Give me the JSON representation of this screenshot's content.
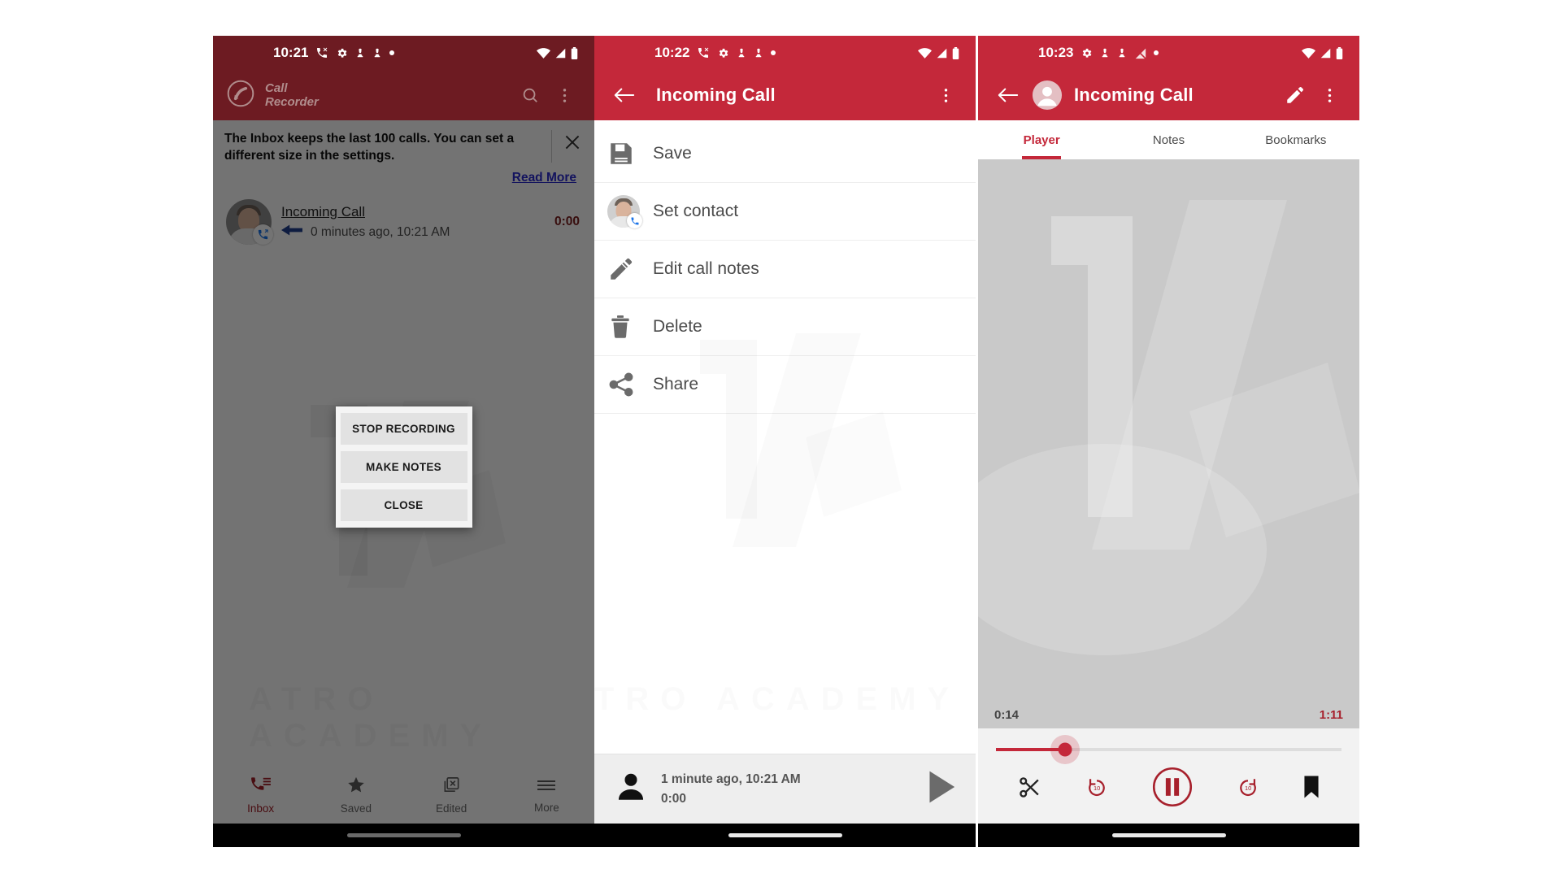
{
  "watermark": {
    "text": "ATRO ACADEMY",
    "brand_letters": "A1"
  },
  "panel1": {
    "status_bar": {
      "time": "10:21",
      "icons": [
        "phone-call-icon",
        "gear-icon",
        "chess-pawn-icon",
        "chess-pawn-icon",
        "dot-icon"
      ],
      "right_icons": [
        "wifi-icon",
        "signal-icon",
        "battery-icon"
      ]
    },
    "app_bar": {
      "logo_icon": "call-recorder-logo-icon",
      "brand_line1": "Call",
      "brand_line2": "Recorder",
      "search_icon": "search-icon",
      "overflow_icon": "more-vertical-icon"
    },
    "banner": {
      "message": "The Inbox keeps the last 100 calls. You can set a different size in the settings.",
      "close_icon": "close-icon",
      "read_more": "Read More"
    },
    "call_row": {
      "title": "Incoming Call",
      "direction_icon": "incoming-arrow-icon",
      "time": "0 minutes ago, 10:21 AM",
      "duration": "0:00",
      "avatar_icon": "contact-avatar",
      "badge_icon": "incoming-call-badge-icon"
    },
    "dialog": {
      "buttons": [
        {
          "label": "STOP RECORDING",
          "name": "stop-recording-button"
        },
        {
          "label": "MAKE NOTES",
          "name": "make-notes-button"
        },
        {
          "label": "CLOSE",
          "name": "close-button"
        }
      ]
    },
    "bottom_nav": [
      {
        "label": "Inbox",
        "icon": "inbox-phone-icon",
        "active": true
      },
      {
        "label": "Saved",
        "icon": "star-icon",
        "active": false
      },
      {
        "label": "Edited",
        "icon": "edited-box-icon",
        "active": false
      },
      {
        "label": "More",
        "icon": "hamburger-icon",
        "active": false
      }
    ]
  },
  "panel2": {
    "status_bar": {
      "time": "10:22",
      "icons": [
        "phone-call-icon",
        "gear-icon",
        "chess-pawn-icon",
        "chess-pawn-icon",
        "dot-icon"
      ],
      "right_icons": [
        "wifi-icon",
        "signal-icon",
        "battery-icon"
      ]
    },
    "app_bar": {
      "back_icon": "back-arrow-icon",
      "title": "Incoming Call",
      "overflow_icon": "more-vertical-icon"
    },
    "menu": [
      {
        "label": "Save",
        "icon": "save-floppy-icon",
        "name": "menu-item-save"
      },
      {
        "label": "Set contact",
        "icon": "contact-avatar-icon",
        "name": "menu-item-set-contact"
      },
      {
        "label": "Edit call notes",
        "icon": "pencil-icon",
        "name": "menu-item-edit-call-notes"
      },
      {
        "label": "Delete",
        "icon": "trash-icon",
        "name": "menu-item-delete"
      },
      {
        "label": "Share",
        "icon": "share-icon",
        "name": "menu-item-share"
      }
    ],
    "mini_player": {
      "avatar_icon": "person-icon",
      "title": "1 minute ago, 10:21 AM",
      "duration": "0:00",
      "play_icon": "play-icon"
    }
  },
  "panel3": {
    "status_bar": {
      "time": "10:23",
      "icons": [
        "gear-icon",
        "chess-pawn-icon",
        "chess-pawn-icon",
        "signal-slash-icon",
        "dot-icon"
      ],
      "right_icons": [
        "wifi-icon",
        "signal-icon",
        "battery-icon"
      ]
    },
    "app_bar": {
      "back_icon": "back-arrow-icon",
      "avatar_icon": "person-circle-icon",
      "title": "Incoming Call",
      "edit_icon": "pencil-icon",
      "overflow_icon": "more-vertical-icon"
    },
    "tabs": [
      {
        "label": "Player",
        "active": true
      },
      {
        "label": "Notes",
        "active": false
      },
      {
        "label": "Bookmarks",
        "active": false
      }
    ],
    "player": {
      "current_time": "0:14",
      "total_time": "1:11",
      "progress_percent": 20,
      "controls": [
        {
          "icon": "scissors-icon",
          "name": "trim-button"
        },
        {
          "icon": "rewind-10-icon",
          "name": "rewind-button"
        },
        {
          "icon": "pause-circle-icon",
          "name": "pause-button"
        },
        {
          "icon": "forward-10-icon",
          "name": "forward-button"
        },
        {
          "icon": "bookmark-icon",
          "name": "bookmark-button"
        }
      ]
    }
  },
  "colors": {
    "primary_red": "#c4283a",
    "dark_red": "#6d1b22",
    "accent_red": "#a7202c",
    "link_blue": "#2a2ad0"
  }
}
